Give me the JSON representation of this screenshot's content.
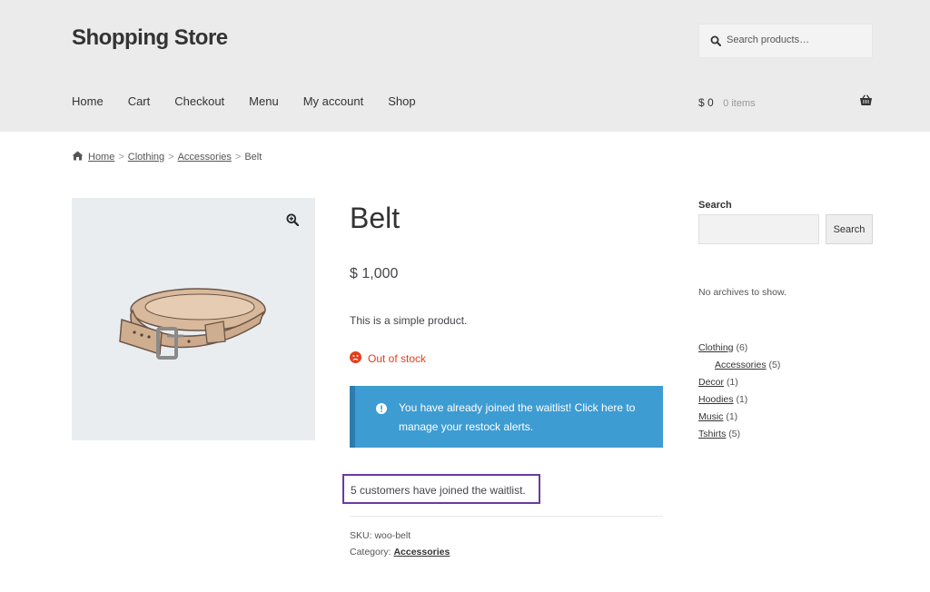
{
  "header": {
    "site_title": "Shopping Store",
    "search_placeholder": "Search products…",
    "nav": [
      "Home",
      "Cart",
      "Checkout",
      "Menu",
      "My account",
      "Shop"
    ],
    "cart_amount": "$ 0",
    "cart_items": "0 items"
  },
  "breadcrumb": [
    "Home",
    "Clothing",
    "Accessories",
    "Belt"
  ],
  "product": {
    "title": "Belt",
    "price": "$ 1,000",
    "description": "This is a simple product.",
    "stock": "Out of stock",
    "notice": "You have already joined the waitlist! Click here to manage your restock alerts.",
    "waitlist_count": "5 customers have joined the waitlist.",
    "sku_label": "SKU:",
    "sku": "woo-belt",
    "category_label": "Category:",
    "category": "Accessories"
  },
  "sidebar": {
    "search_heading": "Search",
    "search_button": "Search",
    "archives": "No archives to show.",
    "categories": [
      {
        "name": "Clothing",
        "count": "(6)"
      },
      {
        "name": "Accessories",
        "count": "(5)"
      },
      {
        "name": "Decor",
        "count": "(1)"
      },
      {
        "name": "Hoodies",
        "count": "(1)"
      },
      {
        "name": "Music",
        "count": "(1)"
      },
      {
        "name": "Tshirts",
        "count": "(5)"
      }
    ]
  },
  "colors": {
    "header_bg": "#ebebeb",
    "notice_bg": "#3d9cd2",
    "stock_red": "#e2401c",
    "highlight_border": "#6a3a9f"
  },
  "icons": [
    "search-icon",
    "basket-icon",
    "home-icon",
    "zoom-icon",
    "sad-face-icon",
    "info-icon"
  ]
}
